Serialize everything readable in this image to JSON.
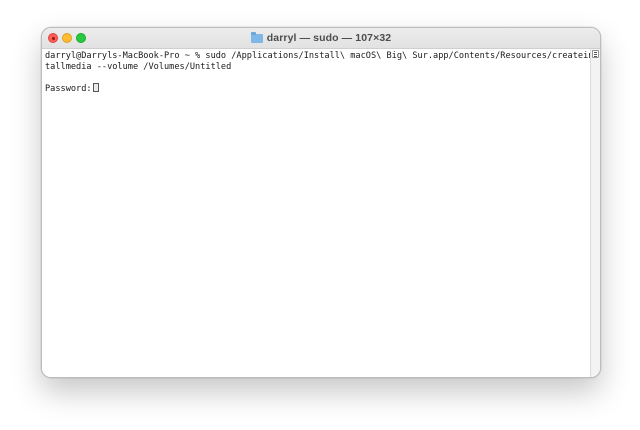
{
  "window": {
    "title": "darryl — sudo — 107×32",
    "title_icon": "folder-icon"
  },
  "traffic_lights": {
    "close": "#ff5f57",
    "minimize": "#febc2e",
    "maximize": "#28c840"
  },
  "terminal": {
    "lines": [
      "darryl@Darryls-MacBook-Pro ~ % sudo /Applications/Install\\ macOS\\ Big\\ Sur.app/Contents/Resources/createins",
      "tallmedia --volume /Volumes/Untitled",
      "",
      "Password:"
    ]
  }
}
